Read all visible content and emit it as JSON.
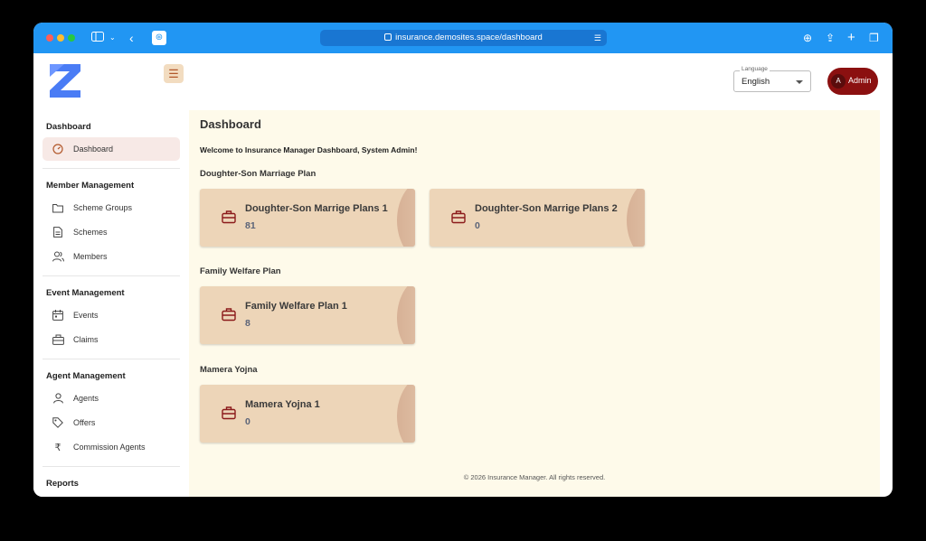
{
  "browser": {
    "url": "insurance.demosites.space/dashboard"
  },
  "header": {
    "language_label": "Language",
    "language_value": "English",
    "user_initial": "A",
    "user_name": "Admin"
  },
  "sidebar": {
    "sections": [
      {
        "title": "Dashboard",
        "items": [
          "Dashboard"
        ]
      },
      {
        "title": "Member Management",
        "items": [
          "Scheme Groups",
          "Schemes",
          "Members"
        ]
      },
      {
        "title": "Event Management",
        "items": [
          "Events",
          "Claims"
        ]
      },
      {
        "title": "Agent Management",
        "items": [
          "Agents",
          "Offers",
          "Commission Agents"
        ]
      },
      {
        "title": "Reports"
      }
    ],
    "active_item": "Dashboard",
    "commission_symbol": "₹"
  },
  "main": {
    "title": "Dashboard",
    "welcome": "Welcome to Insurance Manager Dashboard, System Admin!",
    "groups": [
      {
        "title": "Doughter-Son Marriage Plan",
        "cards": [
          {
            "name": "Doughter-Son Marrige Plans 1",
            "count": "81"
          },
          {
            "name": "Doughter-Son Marrige Plans 2",
            "count": "0"
          }
        ]
      },
      {
        "title": "Family Welfare Plan",
        "cards": [
          {
            "name": "Family Welfare Plan 1",
            "count": "8"
          }
        ]
      },
      {
        "title": "Mamera Yojna",
        "cards": [
          {
            "name": "Mamera Yojna 1",
            "count": "0"
          }
        ]
      }
    ],
    "footer": "© 2026 Insurance Manager. All rights reserved."
  },
  "colors": {
    "titlebar": "#2196f3",
    "accent": "#b2582b",
    "card": "#edd5b8",
    "main_bg": "#fefaea",
    "admin": "#8b1010"
  }
}
